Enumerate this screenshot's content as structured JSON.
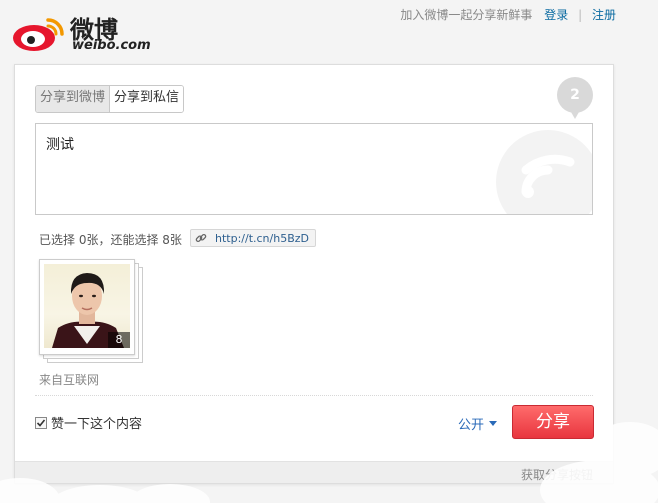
{
  "header": {
    "logo_cn": "微博",
    "logo_en": "weibo.com",
    "slogan": "加入微博一起分享新鲜事",
    "login": "登录",
    "separator": "|",
    "register": "注册"
  },
  "tabs": [
    {
      "label": "分享到微博",
      "active": true
    },
    {
      "label": "分享到私信",
      "active": false
    }
  ],
  "remaining_count": "2",
  "editor": {
    "value": "测试"
  },
  "images": {
    "selection_text": "已选择 0张，还能选择 8张",
    "short_link": "http://t.cn/h5BzD",
    "thumbnail_count": "8",
    "source": "来自互联网"
  },
  "actions": {
    "like_label": "赞一下这个内容",
    "like_checked": true,
    "privacy": "公开",
    "share": "分享"
  },
  "footer": {
    "get_button_link": "获取分享按钮"
  },
  "colors": {
    "accent_red": "#e8363f",
    "link_blue": "#0a6aa1"
  }
}
